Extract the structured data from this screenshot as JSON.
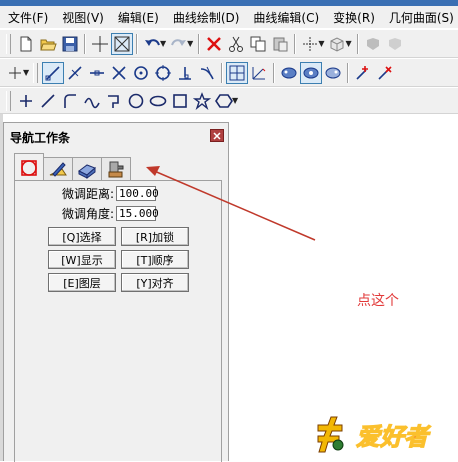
{
  "menu": [
    "文件(F)",
    "视图(V)",
    "编辑(E)",
    "曲线绘制(D)",
    "曲线编辑(C)",
    "变换(R)",
    "几何曲面(S)"
  ],
  "panel": {
    "title": "导航工作条",
    "fields": [
      {
        "label": "微调距离:",
        "value": "100.00"
      },
      {
        "label": "微调角度:",
        "value": "15.000"
      }
    ],
    "buttons": [
      "[Q]选择",
      "[R]加锁",
      "[W]显示",
      "[T]顺序",
      "[E]图层",
      "[Y]对齐"
    ]
  },
  "annotation": "点这个",
  "logo_text": "爱好者",
  "colors": {
    "annotation": "#e23a3a",
    "arrow": "#c0392b",
    "pressed": "#dbeaf7"
  }
}
